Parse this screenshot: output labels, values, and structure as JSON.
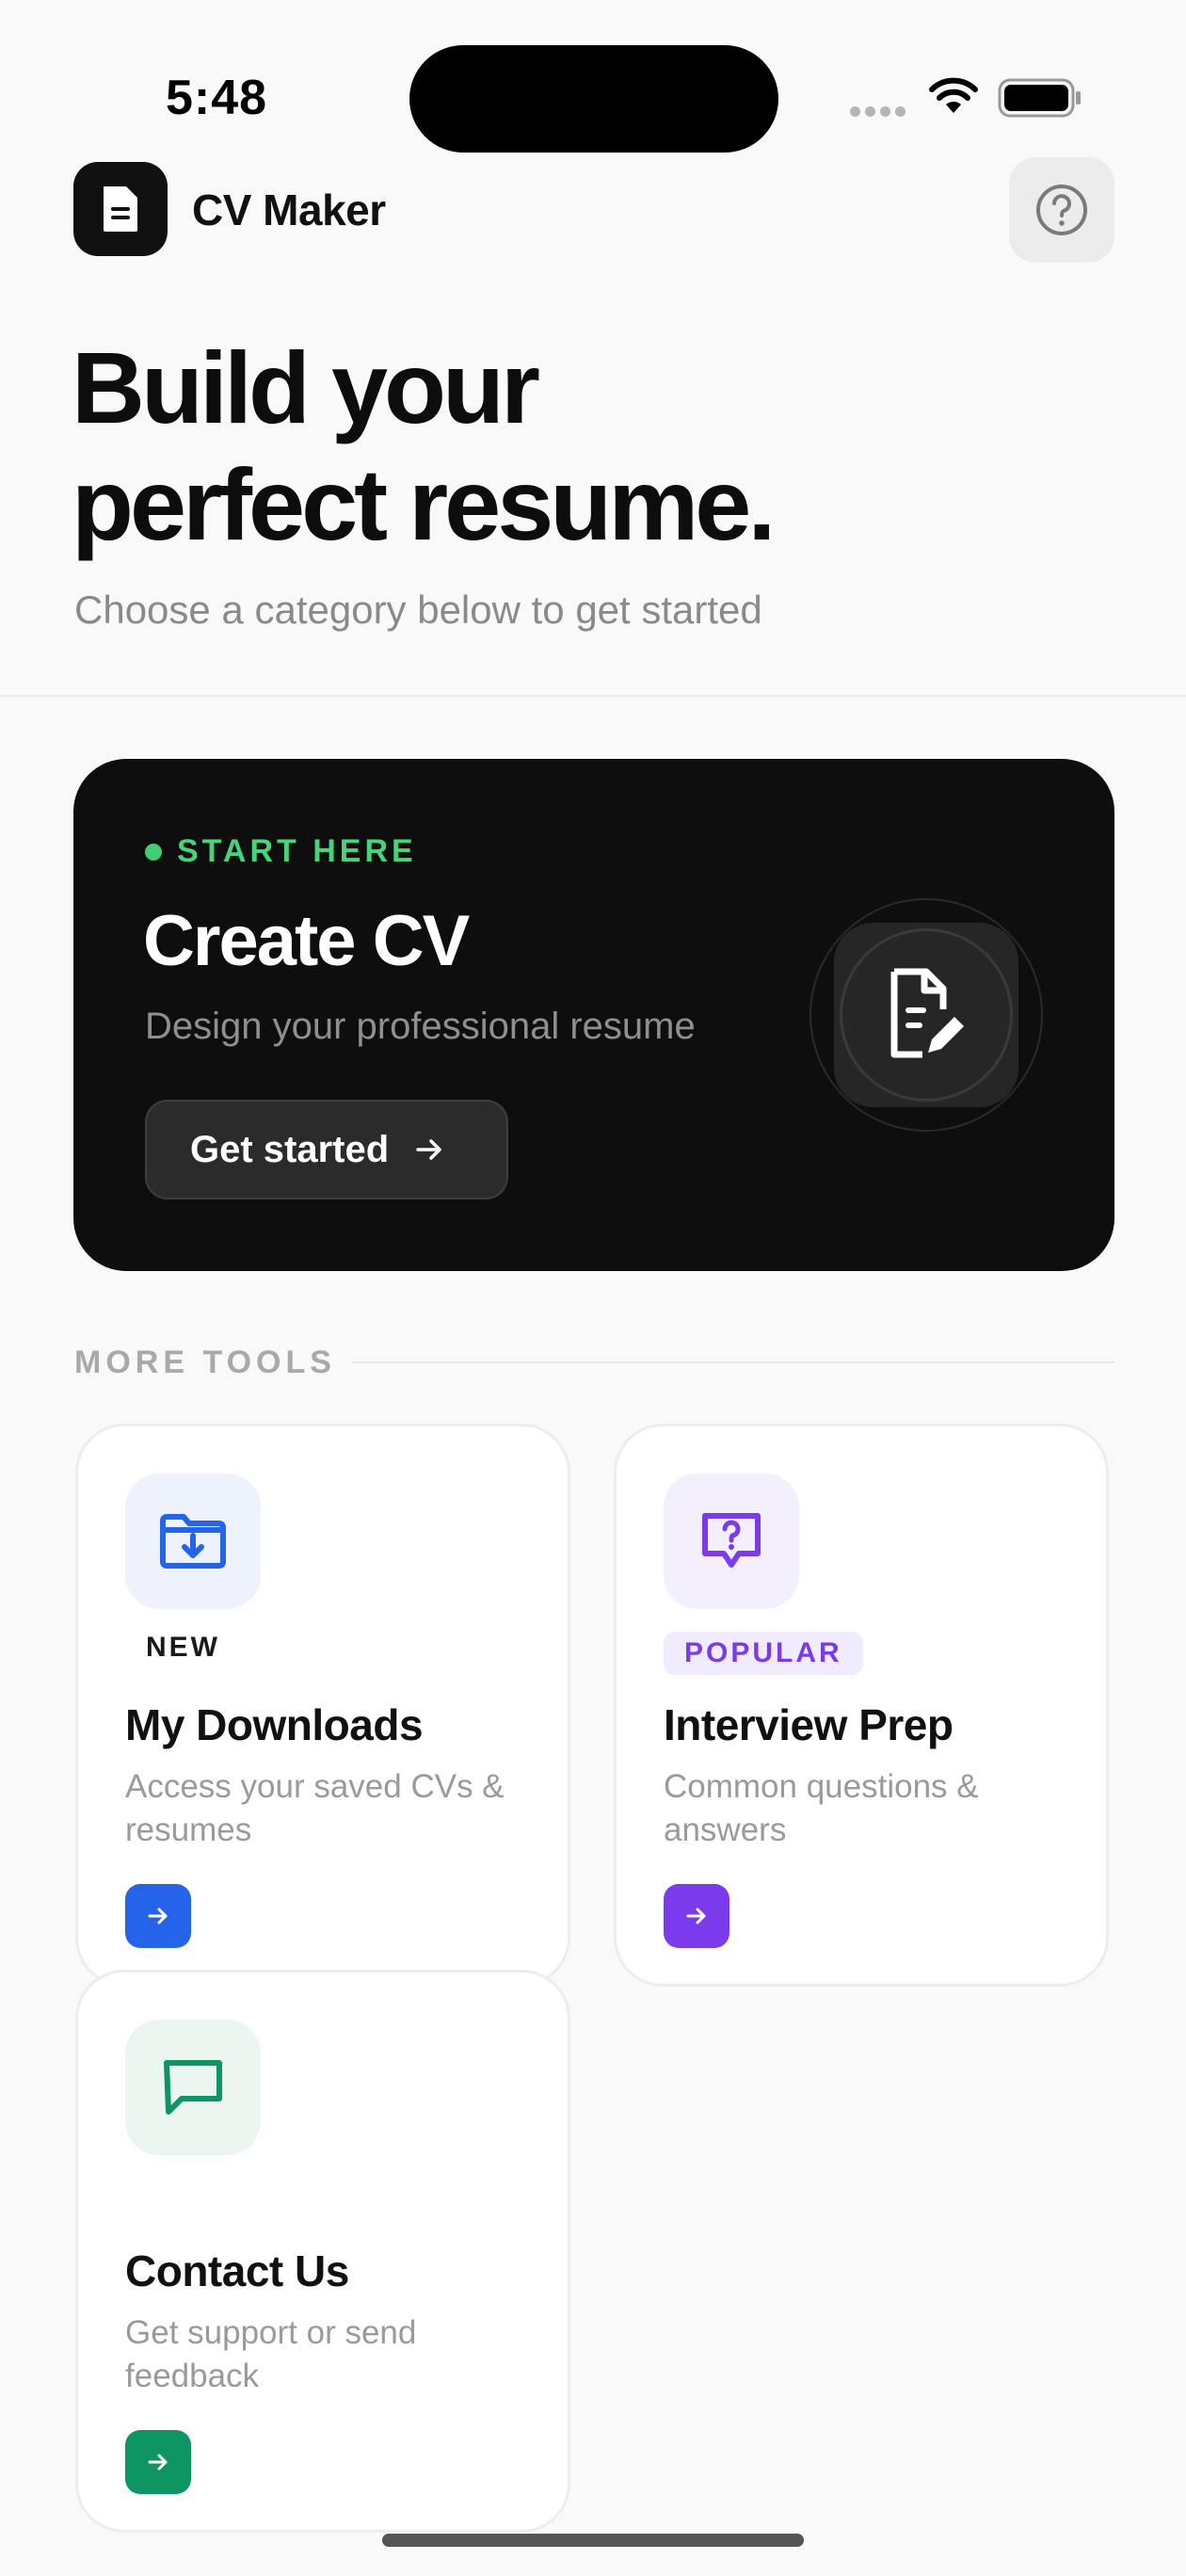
{
  "status_bar": {
    "time": "5:48"
  },
  "header": {
    "app_title": "CV Maker",
    "logo_icon": "document-icon",
    "help_icon": "question-circle-icon"
  },
  "hero": {
    "title_line1": "Build your",
    "title_line2": "perfect resume.",
    "subtitle": "Choose a category below to get started"
  },
  "create_card": {
    "eyebrow": "START HERE",
    "title": "Create CV",
    "subtitle": "Design your professional resume",
    "button_label": "Get started",
    "icon": "document-edit-icon",
    "accent": "#46d37b"
  },
  "more_tools": {
    "label": "MORE TOOLS",
    "items": [
      {
        "badge": "NEW",
        "title": "My Downloads",
        "description": "Access your saved CVs & resumes",
        "icon": "folder-download-icon",
        "accent": "#2563eb",
        "icon_bg": "#eef2fd"
      },
      {
        "badge": "POPULAR",
        "title": "Interview Prep",
        "description": "Common questions & answers",
        "icon": "question-bubble-icon",
        "accent": "#7c3aed",
        "icon_bg": "#f4effd"
      },
      {
        "badge": "",
        "title": "Contact Us",
        "description": "Get support or send feedback",
        "icon": "chat-icon",
        "accent": "#0f9463",
        "icon_bg": "#ebf6f0"
      }
    ]
  }
}
